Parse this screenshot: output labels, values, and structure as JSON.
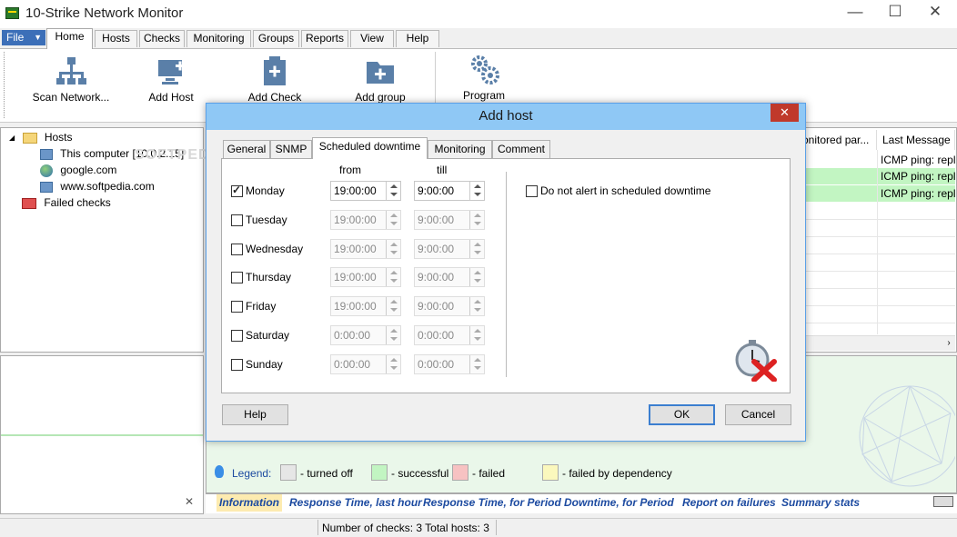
{
  "window": {
    "title": "10-Strike Network Monitor",
    "controls": {
      "minimize": "—",
      "maximize": "☐",
      "close": "✕"
    }
  },
  "menu": {
    "file": "File",
    "tabs": [
      "Home",
      "Hosts",
      "Checks",
      "Monitoring",
      "Groups",
      "Reports",
      "View",
      "Help"
    ],
    "active": "Home"
  },
  "ribbon": {
    "buttons": [
      {
        "label": "Scan Network...",
        "icon": "network-topology-icon"
      },
      {
        "label": "Add Host",
        "icon": "add-host-icon"
      },
      {
        "label": "Add Check",
        "icon": "add-check-icon"
      },
      {
        "label": "Add group",
        "icon": "add-group-icon"
      },
      {
        "label": "Program",
        "icon": "gears-icon"
      }
    ]
  },
  "tree": {
    "root": "Hosts",
    "items": [
      {
        "label": "This computer [10.0.2.15]",
        "icon": "computer-icon"
      },
      {
        "label": "google.com",
        "icon": "globe-icon"
      },
      {
        "label": "www.softpedia.com",
        "icon": "computer-icon"
      }
    ],
    "failed": "Failed checks",
    "watermark": "SOFTPEDIA"
  },
  "grid": {
    "headers": [
      "onitored par...",
      "Last Message"
    ],
    "rows": [
      {
        "message": "ICMP ping: repl",
        "status": "white"
      },
      {
        "message": "ICMP ping: repl",
        "status": "success"
      },
      {
        "message": "ICMP ping: repl",
        "status": "success"
      }
    ]
  },
  "dialog": {
    "title": "Add host",
    "close": "✕",
    "tabs": [
      "General",
      "SNMP",
      "Scheduled downtime",
      "Monitoring",
      "Comment"
    ],
    "active_tab": "Scheduled downtime",
    "col_from": "from",
    "col_till": "till",
    "days": [
      {
        "name": "Monday",
        "checked": true,
        "from": "19:00:00",
        "till": "9:00:00"
      },
      {
        "name": "Tuesday",
        "checked": false,
        "from": "19:00:00",
        "till": "9:00:00"
      },
      {
        "name": "Wednesday",
        "checked": false,
        "from": "19:00:00",
        "till": "9:00:00"
      },
      {
        "name": "Thursday",
        "checked": false,
        "from": "19:00:00",
        "till": "9:00:00"
      },
      {
        "name": "Friday",
        "checked": false,
        "from": "19:00:00",
        "till": "9:00:00"
      },
      {
        "name": "Saturday",
        "checked": false,
        "from": "0:00:00",
        "till": "0:00:00"
      },
      {
        "name": "Sunday",
        "checked": false,
        "from": "0:00:00",
        "till": "0:00:00"
      }
    ],
    "no_alert_label": "Do not alert in scheduled downtime",
    "no_alert_checked": false,
    "help": "Help",
    "ok": "OK",
    "cancel": "Cancel"
  },
  "legend": {
    "title": "Legend:",
    "items": [
      {
        "label": "- turned off",
        "color": "#e6e6e6"
      },
      {
        "label": "- successful",
        "color": "#c2f5c2"
      },
      {
        "label": "- failed",
        "color": "#f7c2c2"
      },
      {
        "label": "- failed by dependency",
        "color": "#fbf8bd"
      }
    ]
  },
  "bottom_tabs": [
    "Information",
    "Response Time, last hour",
    "Response Time, for Period",
    "Downtime, for Period",
    "Report on failures",
    "Summary stats"
  ],
  "bottom_close": "✕",
  "status": "Number of checks: 3  Total hosts: 3"
}
